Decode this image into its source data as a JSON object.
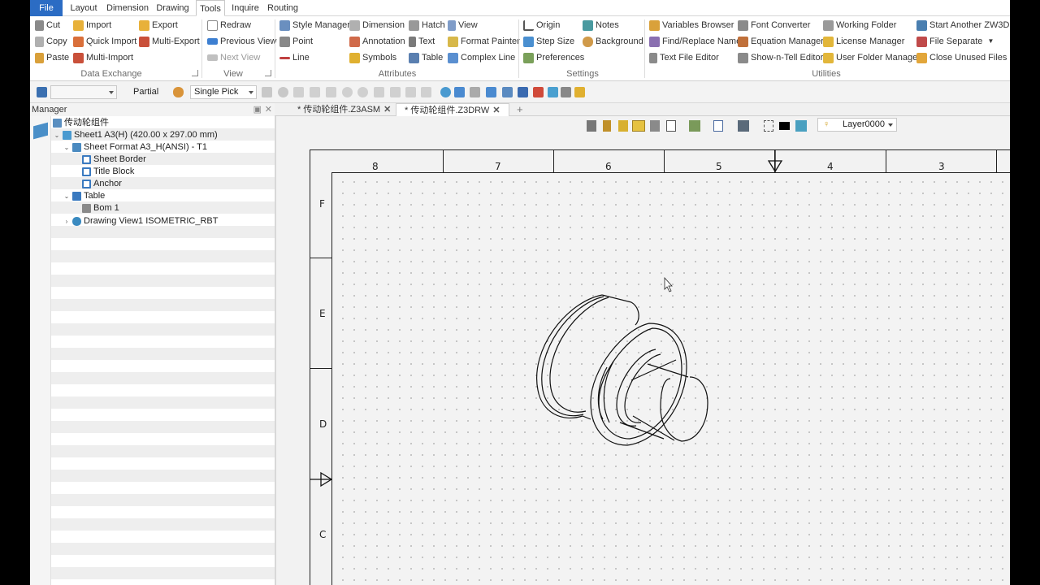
{
  "menubar": {
    "tabs": [
      "File",
      "Layout",
      "Dimension",
      "Drawing",
      "Tools",
      "Inquire",
      "Routing"
    ],
    "active": "Tools"
  },
  "ribbon": {
    "data_exchange": {
      "title": "Data Exchange",
      "cut": "Cut",
      "copy": "Copy",
      "paste": "Paste",
      "import": "Import",
      "quick_import": "Quick Import",
      "multi_import": "Multi-Import",
      "export": "Export",
      "multi_export": "Multi-Export"
    },
    "view": {
      "title": "View",
      "redraw": "Redraw",
      "previous_view": "Previous View",
      "next_view": "Next View"
    },
    "attributes": {
      "title": "Attributes",
      "style_manager": "Style Manager",
      "point": "Point",
      "line": "Line",
      "dimension": "Dimension",
      "annotation": "Annotation",
      "symbols": "Symbols",
      "hatch": "Hatch",
      "text": "Text",
      "table": "Table",
      "view": "View",
      "format_painter": "Format Painter",
      "complex_line": "Complex Line"
    },
    "settings": {
      "title": "Settings",
      "origin": "Origin",
      "step_size": "Step Size",
      "preferences": "Preferences",
      "notes": "Notes",
      "background": "Background"
    },
    "utilities": {
      "title": "Utilities",
      "variables_browser": "Variables Browser",
      "find_replace_name": "Find/Replace Name",
      "text_file_editor": "Text File Editor",
      "font_converter": "Font Converter",
      "equation_manager": "Equation Manager",
      "show_n_tell_editor": "Show-n-Tell Editor",
      "working_folder": "Working Folder",
      "license_manager": "License Manager",
      "user_folder_manager": "User Folder Manager",
      "start_another": "Start Another ZW3D",
      "file_separate": "File Separate",
      "close_unused_files": "Close Unused Files"
    }
  },
  "toolbar2": {
    "filter_value": "",
    "partial": "Partial",
    "pick_mode": "Single Pick"
  },
  "manager": {
    "title": "Manager",
    "tree": [
      {
        "label": "传动轮组件"
      },
      {
        "label": "Sheet1 A3(H) (420.00 x 297.00 mm)"
      },
      {
        "label": "Sheet Format A3_H(ANSI) - T1"
      },
      {
        "label": "Sheet Border"
      },
      {
        "label": "Title Block"
      },
      {
        "label": "Anchor"
      },
      {
        "label": "Table"
      },
      {
        "label": "Bom 1"
      },
      {
        "label": "Drawing View1 ISOMETRIC_RBT"
      }
    ]
  },
  "doc_tabs": [
    {
      "label": "* 传动轮组件.Z3ASM"
    },
    {
      "label": "* 传动轮组件.Z3DRW"
    }
  ],
  "canvas": {
    "layer": "Layer0000",
    "col_zones": [
      "8",
      "7",
      "6",
      "5",
      "4",
      "3"
    ],
    "row_zones": [
      "F",
      "E",
      "D",
      "C"
    ]
  },
  "colors": {
    "file_tab": "#2b6cc4",
    "accent": "#2b6cc4"
  }
}
